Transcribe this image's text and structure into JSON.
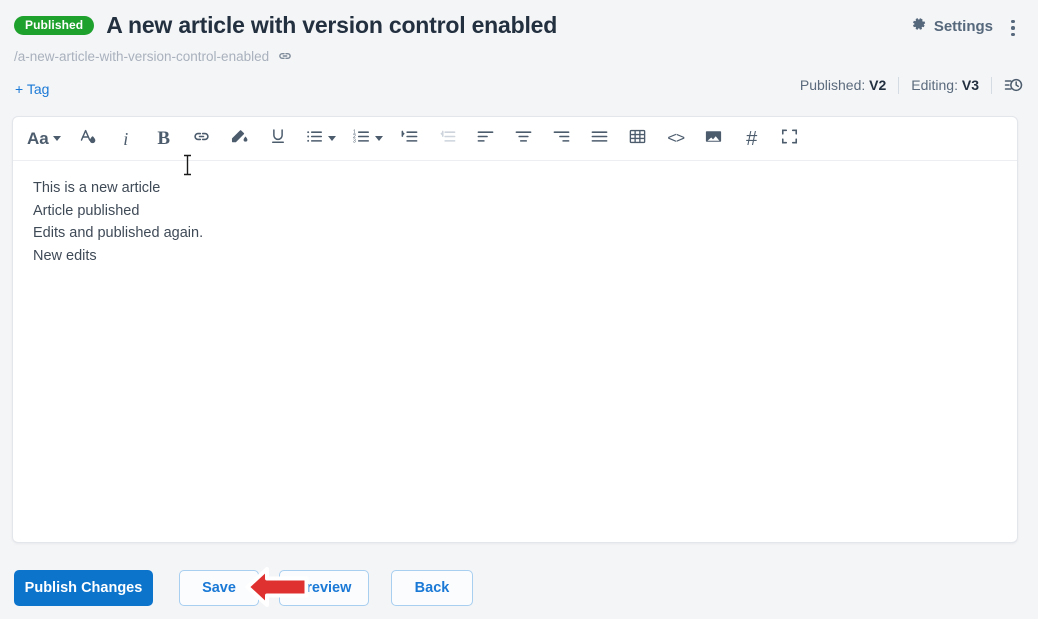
{
  "header": {
    "status_badge": "Published",
    "title": "A new article with version control enabled",
    "slug": "/a-new-article-with-version-control-enabled",
    "link_icon": "link-icon",
    "tag_label": "+ Tag",
    "settings_label": "Settings",
    "settings_icon": "gear-icon",
    "kebab_icon": "more-vertical-icon",
    "published_version_label": "Published:",
    "published_version_value": "V2",
    "editing_version_label": "Editing:",
    "editing_version_value": "V3",
    "history_icon": "history-icon"
  },
  "toolbar": {
    "items": [
      {
        "name": "font-size-icon",
        "label": "Aa",
        "caret": true,
        "disabled": false
      },
      {
        "name": "font-color-icon",
        "label": "",
        "caret": false,
        "disabled": false
      },
      {
        "name": "italic-icon",
        "label": "i",
        "caret": false,
        "disabled": false
      },
      {
        "name": "bold-icon",
        "label": "B",
        "caret": false,
        "disabled": false
      },
      {
        "name": "link-icon",
        "label": "",
        "caret": false,
        "disabled": false
      },
      {
        "name": "highlight-icon",
        "label": "",
        "caret": false,
        "disabled": false
      },
      {
        "name": "underline-icon",
        "label": "U",
        "caret": false,
        "disabled": false
      },
      {
        "name": "bullet-list-icon",
        "label": "",
        "caret": true,
        "disabled": false
      },
      {
        "name": "numbered-list-icon",
        "label": "",
        "caret": true,
        "disabled": false
      },
      {
        "name": "indent-icon",
        "label": "",
        "caret": false,
        "disabled": false
      },
      {
        "name": "outdent-icon",
        "label": "",
        "caret": false,
        "disabled": true
      },
      {
        "name": "align-left-icon",
        "label": "",
        "caret": false,
        "disabled": false
      },
      {
        "name": "align-center-icon",
        "label": "",
        "caret": false,
        "disabled": false
      },
      {
        "name": "align-right-icon",
        "label": "",
        "caret": false,
        "disabled": false
      },
      {
        "name": "align-justify-icon",
        "label": "",
        "caret": false,
        "disabled": false
      },
      {
        "name": "table-icon",
        "label": "",
        "caret": false,
        "disabled": false
      },
      {
        "name": "code-icon",
        "label": "<>",
        "caret": false,
        "disabled": false
      },
      {
        "name": "image-icon",
        "label": "",
        "caret": false,
        "disabled": false
      },
      {
        "name": "anchor-hash-icon",
        "label": "#",
        "caret": false,
        "disabled": false
      },
      {
        "name": "fullscreen-icon",
        "label": "",
        "caret": false,
        "disabled": false
      }
    ]
  },
  "editor": {
    "lines": [
      "This is a new article",
      "Article published",
      "Edits and published again.",
      "New edits"
    ]
  },
  "footer": {
    "publish_label": "Publish Changes",
    "save_label": "Save",
    "preview_label": "Preview",
    "back_label": "Back"
  },
  "annotation": {
    "arrow_icon": "red-left-arrow-annotation",
    "points_at": "Save"
  },
  "cursor": {
    "icon": "text-ibeam-cursor"
  },
  "colors": {
    "page_background": "#f4f5f7",
    "badge_green": "#1fa12e",
    "primary_blue": "#0d74cc",
    "link_blue": "#1a79d6",
    "annotation_red": "#e03131",
    "toolbar_icon": "#4c5c6d",
    "disabled_icon": "#cdd4dc"
  }
}
